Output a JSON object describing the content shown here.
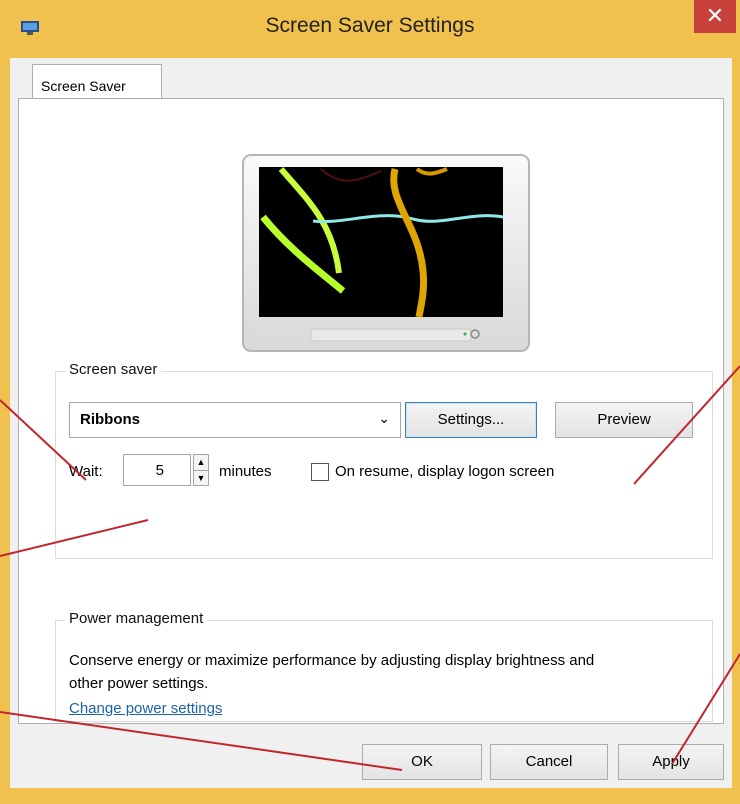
{
  "window": {
    "title": "Screen Saver Settings",
    "close_glyph": "✕"
  },
  "tabs": [
    {
      "label": "Screen Saver"
    }
  ],
  "screen_saver": {
    "group_label": "Screen saver",
    "selected": "Ribbons",
    "dropdown_glyph": "⌄",
    "settings_button": "Settings...",
    "preview_button": "Preview",
    "wait_label": "Wait:",
    "wait_value": "5",
    "minutes_label": "minutes",
    "resume_label": "On resume, display logon screen",
    "resume_checked": false
  },
  "power": {
    "group_label": "Power management",
    "description": "Conserve energy or maximize performance by adjusting display brightness and other power settings.",
    "link": "Change power settings"
  },
  "footer": {
    "ok": "OK",
    "cancel": "Cancel",
    "apply": "Apply"
  },
  "icons": {
    "app": "display-icon",
    "close": "close-icon",
    "spin_up": "▲",
    "spin_down": "▼"
  },
  "colors": {
    "title_bar": "#f1c14e",
    "close": "#c7413a",
    "link": "#1a64a8",
    "annotation": "#c0262c"
  }
}
